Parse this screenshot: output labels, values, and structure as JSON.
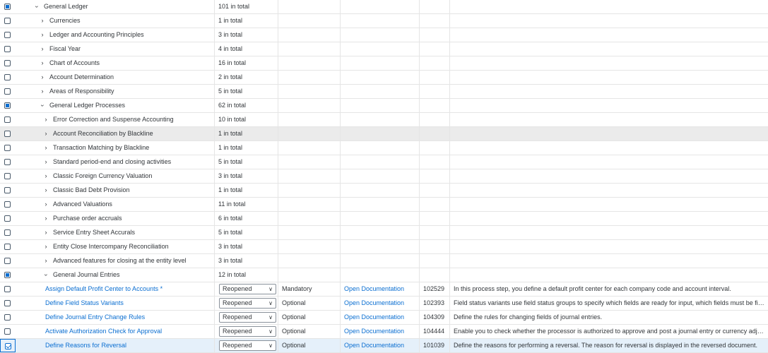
{
  "rows": [
    {
      "kind": "group",
      "indent": 0,
      "expanded": true,
      "check": "partial",
      "name": "General Ledger",
      "count": "101 in total"
    },
    {
      "kind": "group",
      "indent": 1,
      "expanded": false,
      "check": "none",
      "name": "Currencies",
      "count": "1 in total"
    },
    {
      "kind": "group",
      "indent": 1,
      "expanded": false,
      "check": "none",
      "name": "Ledger and Accounting Principles",
      "count": "3 in total"
    },
    {
      "kind": "group",
      "indent": 1,
      "expanded": false,
      "check": "none",
      "name": "Fiscal Year",
      "count": "4 in total"
    },
    {
      "kind": "group",
      "indent": 1,
      "expanded": false,
      "check": "none",
      "name": "Chart of Accounts",
      "count": "16 in total"
    },
    {
      "kind": "group",
      "indent": 1,
      "expanded": false,
      "check": "none",
      "name": "Account Determination",
      "count": "2 in total"
    },
    {
      "kind": "group",
      "indent": 1,
      "expanded": false,
      "check": "none",
      "name": "Areas of Responsibility",
      "count": "5 in total"
    },
    {
      "kind": "group",
      "indent": 1,
      "expanded": true,
      "check": "partial",
      "name": "General Ledger Processes",
      "count": "62 in total"
    },
    {
      "kind": "group",
      "indent": 2,
      "expanded": false,
      "check": "none",
      "name": "Error Correction and Suspense Accounting",
      "count": "10 in total"
    },
    {
      "kind": "group",
      "indent": 2,
      "expanded": false,
      "check": "none",
      "name": "Account Reconciliation by Blackline",
      "count": "1 in total",
      "hover": true
    },
    {
      "kind": "group",
      "indent": 2,
      "expanded": false,
      "check": "none",
      "name": "Transaction Matching by Blackline",
      "count": "1 in total"
    },
    {
      "kind": "group",
      "indent": 2,
      "expanded": false,
      "check": "none",
      "name": "Standard period-end and closing activities",
      "count": "5 in total"
    },
    {
      "kind": "group",
      "indent": 2,
      "expanded": false,
      "check": "none",
      "name": "Classic Foreign Currency Valuation",
      "count": "3 in total"
    },
    {
      "kind": "group",
      "indent": 2,
      "expanded": false,
      "check": "none",
      "name": "Classic Bad Debt Provision",
      "count": "1 in total"
    },
    {
      "kind": "group",
      "indent": 2,
      "expanded": false,
      "check": "none",
      "name": "Advanced Valuations",
      "count": "11 in total"
    },
    {
      "kind": "group",
      "indent": 2,
      "expanded": false,
      "check": "none",
      "name": "Purchase order accruals",
      "count": "6 in total"
    },
    {
      "kind": "group",
      "indent": 2,
      "expanded": false,
      "check": "none",
      "name": "Service Entry Sheet Accurals",
      "count": "5 in total"
    },
    {
      "kind": "group",
      "indent": 2,
      "expanded": false,
      "check": "none",
      "name": "Entity Close Intercompany Reconciliation",
      "count": "3 in total"
    },
    {
      "kind": "group",
      "indent": 2,
      "expanded": false,
      "check": "none",
      "name": "Advanced features for closing at the entity level",
      "count": "3 in total"
    },
    {
      "kind": "group",
      "indent": 2,
      "expanded": true,
      "check": "partial",
      "name": "General Journal Entries",
      "count": "12 in total"
    },
    {
      "kind": "activity",
      "check": "none",
      "name": "Assign Default Profit Center to Accounts *",
      "status": "Reopened",
      "option": "Mandatory",
      "doc": "Open Documentation",
      "id": "102529",
      "desc": "In this process step, you define a default profit center for each company code and account interval."
    },
    {
      "kind": "activity",
      "check": "none",
      "name": "Define Field Status Variants",
      "status": "Reopened",
      "option": "Optional",
      "doc": "Open Documentation",
      "id": "102393",
      "desc": "Field status variants use field status groups to specify which fields are ready for input, which fields must be fille..."
    },
    {
      "kind": "activity",
      "check": "none",
      "name": "Define Journal Entry Change Rules",
      "status": "Reopened",
      "option": "Optional",
      "doc": "Open Documentation",
      "id": "104309",
      "desc": "Define the rules for changing fields of journal entries."
    },
    {
      "kind": "activity",
      "check": "none",
      "name": "Activate Authorization Check for Approval",
      "status": "Reopened",
      "option": "Optional",
      "doc": "Open Documentation",
      "id": "104444",
      "desc": "Enable you to check whether the processor is authorized to approve and post a journal entry or currency adjust..."
    },
    {
      "kind": "activity",
      "check": "checked",
      "selected": true,
      "name": "Define Reasons for Reversal",
      "status": "Reopened",
      "option": "Optional",
      "doc": "Open Documentation",
      "id": "101039",
      "desc": "Define the reasons for performing a reversal. The reason for reversal is displayed in the reversed document."
    }
  ]
}
